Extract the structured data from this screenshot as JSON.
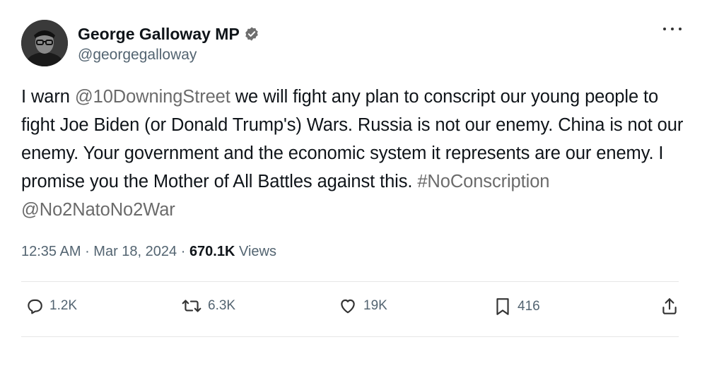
{
  "author": {
    "display_name": "George Galloway MP",
    "handle": "@georgegalloway",
    "avatar_icon": "profile-photo",
    "verified_icon": "verified-badge-icon"
  },
  "tweet": {
    "segments": [
      {
        "text": "I warn ",
        "type": "text"
      },
      {
        "text": "@10DowningStreet",
        "type": "mention"
      },
      {
        "text": " we will fight any plan to conscript our young people to fight Joe Biden (or Donald Trump's) Wars. Russia is not our enemy. China is not our enemy. Your government and the economic system it represents are our enemy. I promise you the Mother of All Battles against this. ",
        "type": "text"
      },
      {
        "text": "#NoConscription",
        "type": "hashtag"
      },
      {
        "text": " ",
        "type": "text"
      },
      {
        "text": "@No2NatoNo2War",
        "type": "mention"
      }
    ]
  },
  "meta": {
    "time": "12:35 AM",
    "separator1": " · ",
    "date": "Mar 18, 2024",
    "separator2": " · ",
    "views_count": "670.1K",
    "views_label": " Views"
  },
  "actions": {
    "replies": "1.2K",
    "reposts": "6.3K",
    "likes": "19K",
    "bookmarks": "416"
  },
  "colors": {
    "text": "#0f1419",
    "secondary": "#536471",
    "link": "#6b6b6b"
  }
}
